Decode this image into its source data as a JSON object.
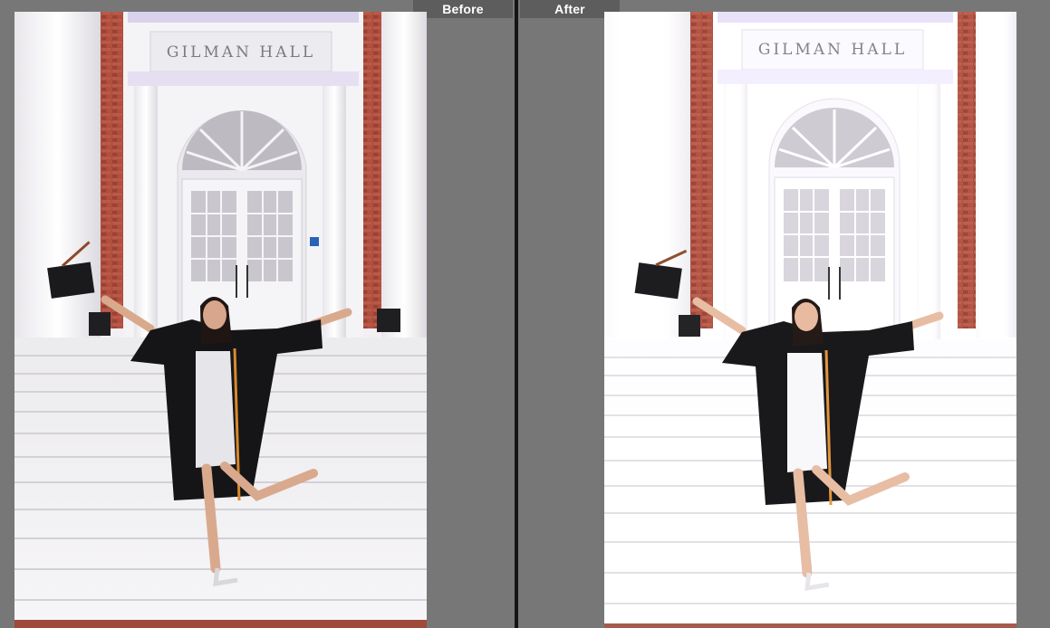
{
  "app": {
    "mode": "before-after-compare"
  },
  "panels": [
    {
      "id": "before",
      "label": "Before"
    },
    {
      "id": "after",
      "label": "After"
    }
  ],
  "photo": {
    "sign_text": "GILMAN HALL"
  },
  "colors": {
    "background": "#777777",
    "divider": "#151515",
    "label_bg": "#5d5d5d",
    "label_text": "#ffffff",
    "brick": "#a84a3c",
    "marble": "#f3f1f3"
  }
}
